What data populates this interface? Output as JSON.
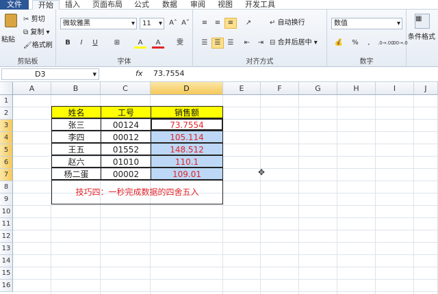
{
  "menu": {
    "file": "文件",
    "tabs": [
      "开始",
      "插入",
      "页面布局",
      "公式",
      "数据",
      "审阅",
      "视图",
      "开发工具"
    ]
  },
  "ribbon": {
    "clipboard": {
      "paste": "粘贴",
      "cut": "剪切",
      "copy": "复制",
      "format_painter": "格式刷",
      "label": "剪贴板"
    },
    "font": {
      "name": "微软雅黑",
      "size": "11",
      "bold": "B",
      "italic": "I",
      "underline": "U",
      "label": "字体",
      "grow": "A˄",
      "shrink": "A˅",
      "fill_glyph": "A",
      "font_color_glyph": "A",
      "phonetic": "雯"
    },
    "align": {
      "wrap": "自动换行",
      "merge": "合并后居中",
      "label": "对齐方式"
    },
    "number": {
      "format": "数值",
      "percent": "%",
      "comma": ",",
      "label": "数字",
      "inc": ".0→.00",
      "dec": ".00→.0"
    },
    "styles": {
      "conditional": "条件格式"
    }
  },
  "formula_bar": {
    "name_box": "D3",
    "fx": "fx",
    "value": "73.7554"
  },
  "columns": [
    "A",
    "B",
    "C",
    "D",
    "E",
    "F",
    "G",
    "H",
    "I",
    "J"
  ],
  "rows": [
    "1",
    "2",
    "3",
    "4",
    "5",
    "6",
    "7",
    "8",
    "9",
    "10",
    "11",
    "12",
    "13",
    "14",
    "15",
    "16"
  ],
  "table": {
    "headers": [
      "姓名",
      "工号",
      "销售额"
    ],
    "rows": [
      [
        "张三",
        "00124",
        "73.7554"
      ],
      [
        "李四",
        "00012",
        "105.114"
      ],
      [
        "王五",
        "01552",
        "148.512"
      ],
      [
        "赵六",
        "01010",
        "110.1"
      ],
      [
        "杨二蛋",
        "00002",
        "109.01"
      ]
    ]
  },
  "note": "技巧四：一秒完成数据的四舍五入",
  "colors": {
    "header_fill": "#ffff00",
    "value_red": "#e0252a",
    "selection_blue": "#bcd8f6"
  }
}
